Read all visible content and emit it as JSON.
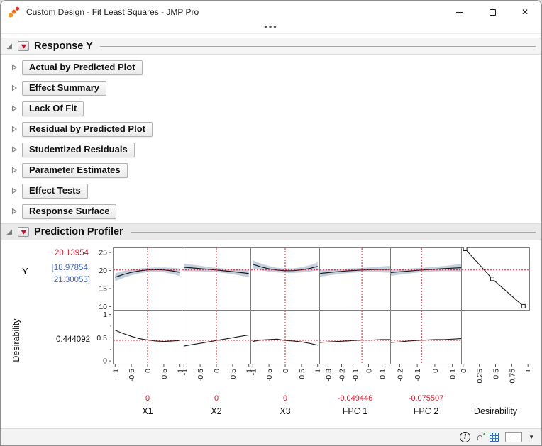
{
  "window": {
    "title": "Custom Design - Fit Least Squares - JMP Pro",
    "toolbar_dots": "•••"
  },
  "icons": {
    "minimize": "—",
    "maximize": "maximize-box",
    "close": "✕",
    "red_triangle": "▼",
    "disclosure_closed": "▷",
    "disclosure_open": "◢",
    "info": "i",
    "home": "⌂",
    "up": "▲",
    "grid": "▦",
    "caret": "▼"
  },
  "colors": {
    "accent_red": "#cf2030",
    "ci_blue": "#4466bb",
    "band_fill": "#bfcbdc",
    "curve": "#1a1a1a",
    "cell_border": "#808080"
  },
  "sections": {
    "response": {
      "label": "Response Y"
    },
    "collapsed": [
      "Actual by Predicted Plot",
      "Effect Summary",
      "Lack Of Fit",
      "Residual by Predicted Plot",
      "Studentized Residuals",
      "Parameter Estimates",
      "Effect Tests",
      "Response Surface"
    ],
    "profiler_label": "Prediction Profiler"
  },
  "profiler": {
    "y_label": "Y",
    "predicted_text": "20.13954",
    "ci_line1": "[18.97854,",
    "ci_line2": "21.30053]",
    "desirability_label": "Desirability",
    "desirability_value_text": "0.444092"
  },
  "chart_data": {
    "type": "profiler",
    "response_axis": {
      "name": "Y",
      "ticks": [
        25,
        20,
        15,
        10
      ],
      "lim": [
        9.1,
        26.4
      ],
      "predicted": 20.13954,
      "ci": [
        18.97854,
        21.30053
      ]
    },
    "desirability_axis": {
      "ticks": [
        1,
        0.5,
        0
      ],
      "tick_labels": [
        "1",
        "0.5",
        "0"
      ],
      "minor_ticks": [
        0.75,
        0.25
      ],
      "lim": [
        -0.06,
        1.1
      ],
      "value": 0.444092
    },
    "columns": [
      {
        "name": "X1",
        "current": 0,
        "current_label": "0",
        "xlim": [
          -1.05,
          1.05
        ],
        "xticks": [
          -1,
          -0.5,
          0,
          0.5,
          1
        ],
        "xtick_labels": [
          "-1",
          "-0.5",
          "0",
          "0.5",
          "1"
        ],
        "x": [
          -1,
          -0.75,
          -0.5,
          -0.25,
          0,
          0.25,
          0.5,
          0.75,
          1
        ],
        "y": [
          18.14,
          18.9,
          19.49,
          19.91,
          20.17,
          20.25,
          20.17,
          19.91,
          19.49
        ],
        "band": [
          1.1,
          0.95,
          0.8,
          0.68,
          0.6,
          0.6,
          0.68,
          0.85,
          1.05
        ],
        "d": [
          0.66,
          0.59,
          0.53,
          0.48,
          0.45,
          0.43,
          0.42,
          0.43,
          0.44
        ]
      },
      {
        "name": "X2",
        "current": 0,
        "current_label": "0",
        "xlim": [
          -1.05,
          1.05
        ],
        "xticks": [
          -1,
          -0.5,
          0,
          0.5,
          1
        ],
        "xtick_labels": [
          "-1",
          "-0.5",
          "0",
          "0.5",
          "1"
        ],
        "x": [
          -1,
          -0.75,
          -0.5,
          -0.25,
          0,
          0.25,
          0.5,
          0.75,
          1
        ],
        "y": [
          20.89,
          20.72,
          20.54,
          20.34,
          20.14,
          19.92,
          19.69,
          19.45,
          19.19
        ],
        "band": [
          1.05,
          0.9,
          0.78,
          0.66,
          0.6,
          0.62,
          0.7,
          0.85,
          1.05
        ],
        "d": [
          0.32,
          0.35,
          0.38,
          0.41,
          0.44,
          0.47,
          0.5,
          0.53,
          0.56
        ]
      },
      {
        "name": "X3",
        "current": 0,
        "current_label": "0",
        "xlim": [
          -1.05,
          1.05
        ],
        "xticks": [
          -1,
          -0.5,
          0,
          0.5,
          1
        ],
        "xtick_labels": [
          "-1",
          "-0.5",
          "0",
          "0.5",
          "1"
        ],
        "x": [
          -1,
          -0.75,
          -0.5,
          -0.25,
          0,
          0.25,
          0.5,
          0.75,
          1
        ],
        "y": [
          21.75,
          21.02,
          20.48,
          20.12,
          19.95,
          19.97,
          20.18,
          20.57,
          21.15
        ],
        "band": [
          1.1,
          0.92,
          0.78,
          0.66,
          0.6,
          0.64,
          0.72,
          0.88,
          1.08
        ],
        "d": [
          0.42,
          0.45,
          0.46,
          0.47,
          0.44,
          0.43,
          0.41,
          0.38,
          0.34
        ]
      },
      {
        "name": "FPC 1",
        "current": -0.049446,
        "current_label": "-0.049446",
        "xlim": [
          -0.36,
          0.16
        ],
        "xticks": [
          -0.3,
          -0.2,
          -0.1,
          0,
          0.1
        ],
        "xtick_labels": [
          "-0.3",
          "-0.2",
          "-0.1",
          "0",
          "0.1"
        ],
        "x": [
          -0.36,
          -0.295,
          -0.23,
          -0.165,
          -0.1,
          -0.035,
          0.03,
          0.095,
          0.16
        ],
        "y": [
          19.19,
          19.45,
          19.68,
          19.88,
          20.04,
          20.16,
          20.26,
          20.32,
          20.34
        ],
        "band": [
          0.95,
          0.82,
          0.72,
          0.64,
          0.6,
          0.62,
          0.7,
          0.82,
          0.95
        ],
        "d": [
          0.4,
          0.41,
          0.42,
          0.43,
          0.44,
          0.45,
          0.45,
          0.46,
          0.46
        ]
      },
      {
        "name": "FPC 2",
        "current": -0.075507,
        "current_label": "-0.075507",
        "xlim": [
          -0.25,
          0.15
        ],
        "xticks": [
          -0.2,
          -0.1,
          0,
          0.1
        ],
        "xtick_labels": [
          "-0.2",
          "-0.1",
          "0",
          "0.1"
        ],
        "x": [
          -0.25,
          -0.2,
          -0.15,
          -0.1,
          -0.05,
          0,
          0.05,
          0.1,
          0.15
        ],
        "y": [
          19.44,
          19.66,
          19.86,
          20.05,
          20.23,
          20.39,
          20.53,
          20.66,
          20.78
        ],
        "band": [
          0.9,
          0.78,
          0.68,
          0.62,
          0.58,
          0.62,
          0.72,
          0.85,
          1.0
        ],
        "d": [
          0.4,
          0.41,
          0.43,
          0.44,
          0.45,
          0.46,
          0.46,
          0.47,
          0.48
        ]
      },
      {
        "name": "Desirability",
        "current": null,
        "current_label": "",
        "xlim": [
          -0.02,
          1.02
        ],
        "xticks": [
          0,
          0.25,
          0.5,
          0.75,
          1
        ],
        "xtick_labels": [
          "0",
          "0.25",
          "0.5",
          "0.75",
          "1"
        ],
        "func": [
          [
            0.03,
            26.0
          ],
          [
            0.45,
            17.7
          ],
          [
            0.93,
            10.1
          ]
        ],
        "no_bottom_cell": true
      }
    ]
  }
}
